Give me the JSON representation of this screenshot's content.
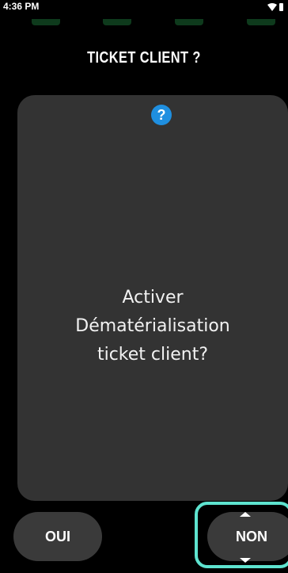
{
  "status_bar": {
    "time": "4:36 PM",
    "icons": [
      "wifi-icon",
      "battery-icon"
    ]
  },
  "pager": {
    "count": 4,
    "color": "#0e3a1c"
  },
  "header": {
    "title": "TICKET CLIENT ?"
  },
  "dialog": {
    "icon": "help-icon",
    "icon_glyph": "?",
    "icon_color": "#1f8fe0",
    "message_lines": [
      "Activer",
      "Dématérialisation",
      "ticket client?"
    ]
  },
  "buttons": {
    "yes_label": "OUI",
    "no_label": "NON"
  },
  "colors": {
    "background": "#000000",
    "card": "#333333",
    "button": "#3a3a3a",
    "focus_highlight": "#5ee3cf"
  }
}
